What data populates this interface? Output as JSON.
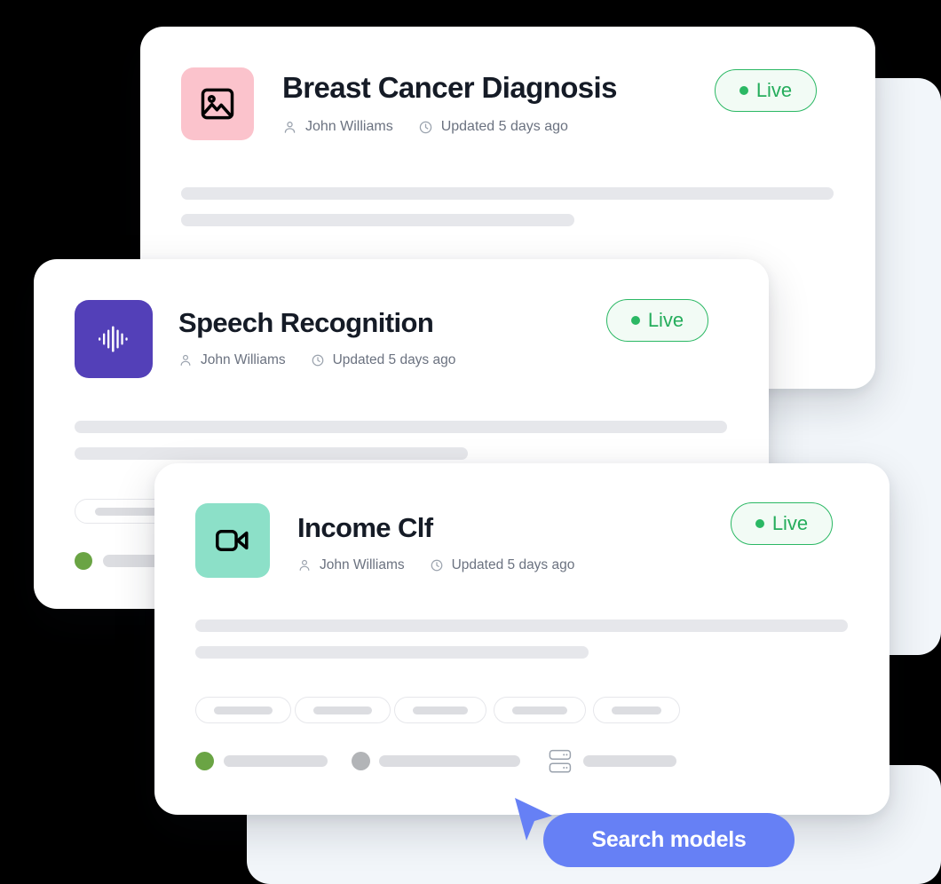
{
  "theme": {
    "background": "#000000",
    "panel_bg": "#f2f6fa",
    "card_bg": "#ffffff",
    "title_color": "#151b26",
    "meta_color": "#6b7280",
    "live_color": "#25ad5c",
    "live_border": "#2bb864",
    "live_bg": "#f2fbf5",
    "skeleton_color": "#e6e7eb",
    "chip_border": "#e6e7eb",
    "chip_fill": "#dcdde1",
    "accent_blue": "#6680f5",
    "status_green": "#6aa444",
    "status_gray": "#b2b4b7"
  },
  "cards": [
    {
      "id": "breast-cancer-diagnosis",
      "title": "Breast Cancer Diagnosis",
      "author": "John Williams",
      "updated": "Updated 5 days ago",
      "status_label": "Live",
      "icon_name": "image-icon",
      "tile_color": "#fbc3cc",
      "icon_color": "#000000"
    },
    {
      "id": "speech-recognition",
      "title": "Speech Recognition",
      "author": "John Williams",
      "updated": "Updated 5 days ago",
      "status_label": "Live",
      "icon_name": "audio-waveform-icon",
      "tile_color": "#5340b8",
      "icon_color": "#ffffff"
    },
    {
      "id": "income-clf",
      "title": "Income Clf",
      "author": "John Williams",
      "updated": "Updated 5 days ago",
      "status_label": "Live",
      "icon_name": "video-camera-icon",
      "tile_color": "#8ce0c8",
      "icon_color": "#000000"
    }
  ],
  "meta_icons": {
    "author": "user-icon",
    "updated": "clock-icon"
  },
  "search": {
    "label": "Search models",
    "cursor": "cursor-arrow-icon"
  },
  "server_icon": "server-stack-icon"
}
